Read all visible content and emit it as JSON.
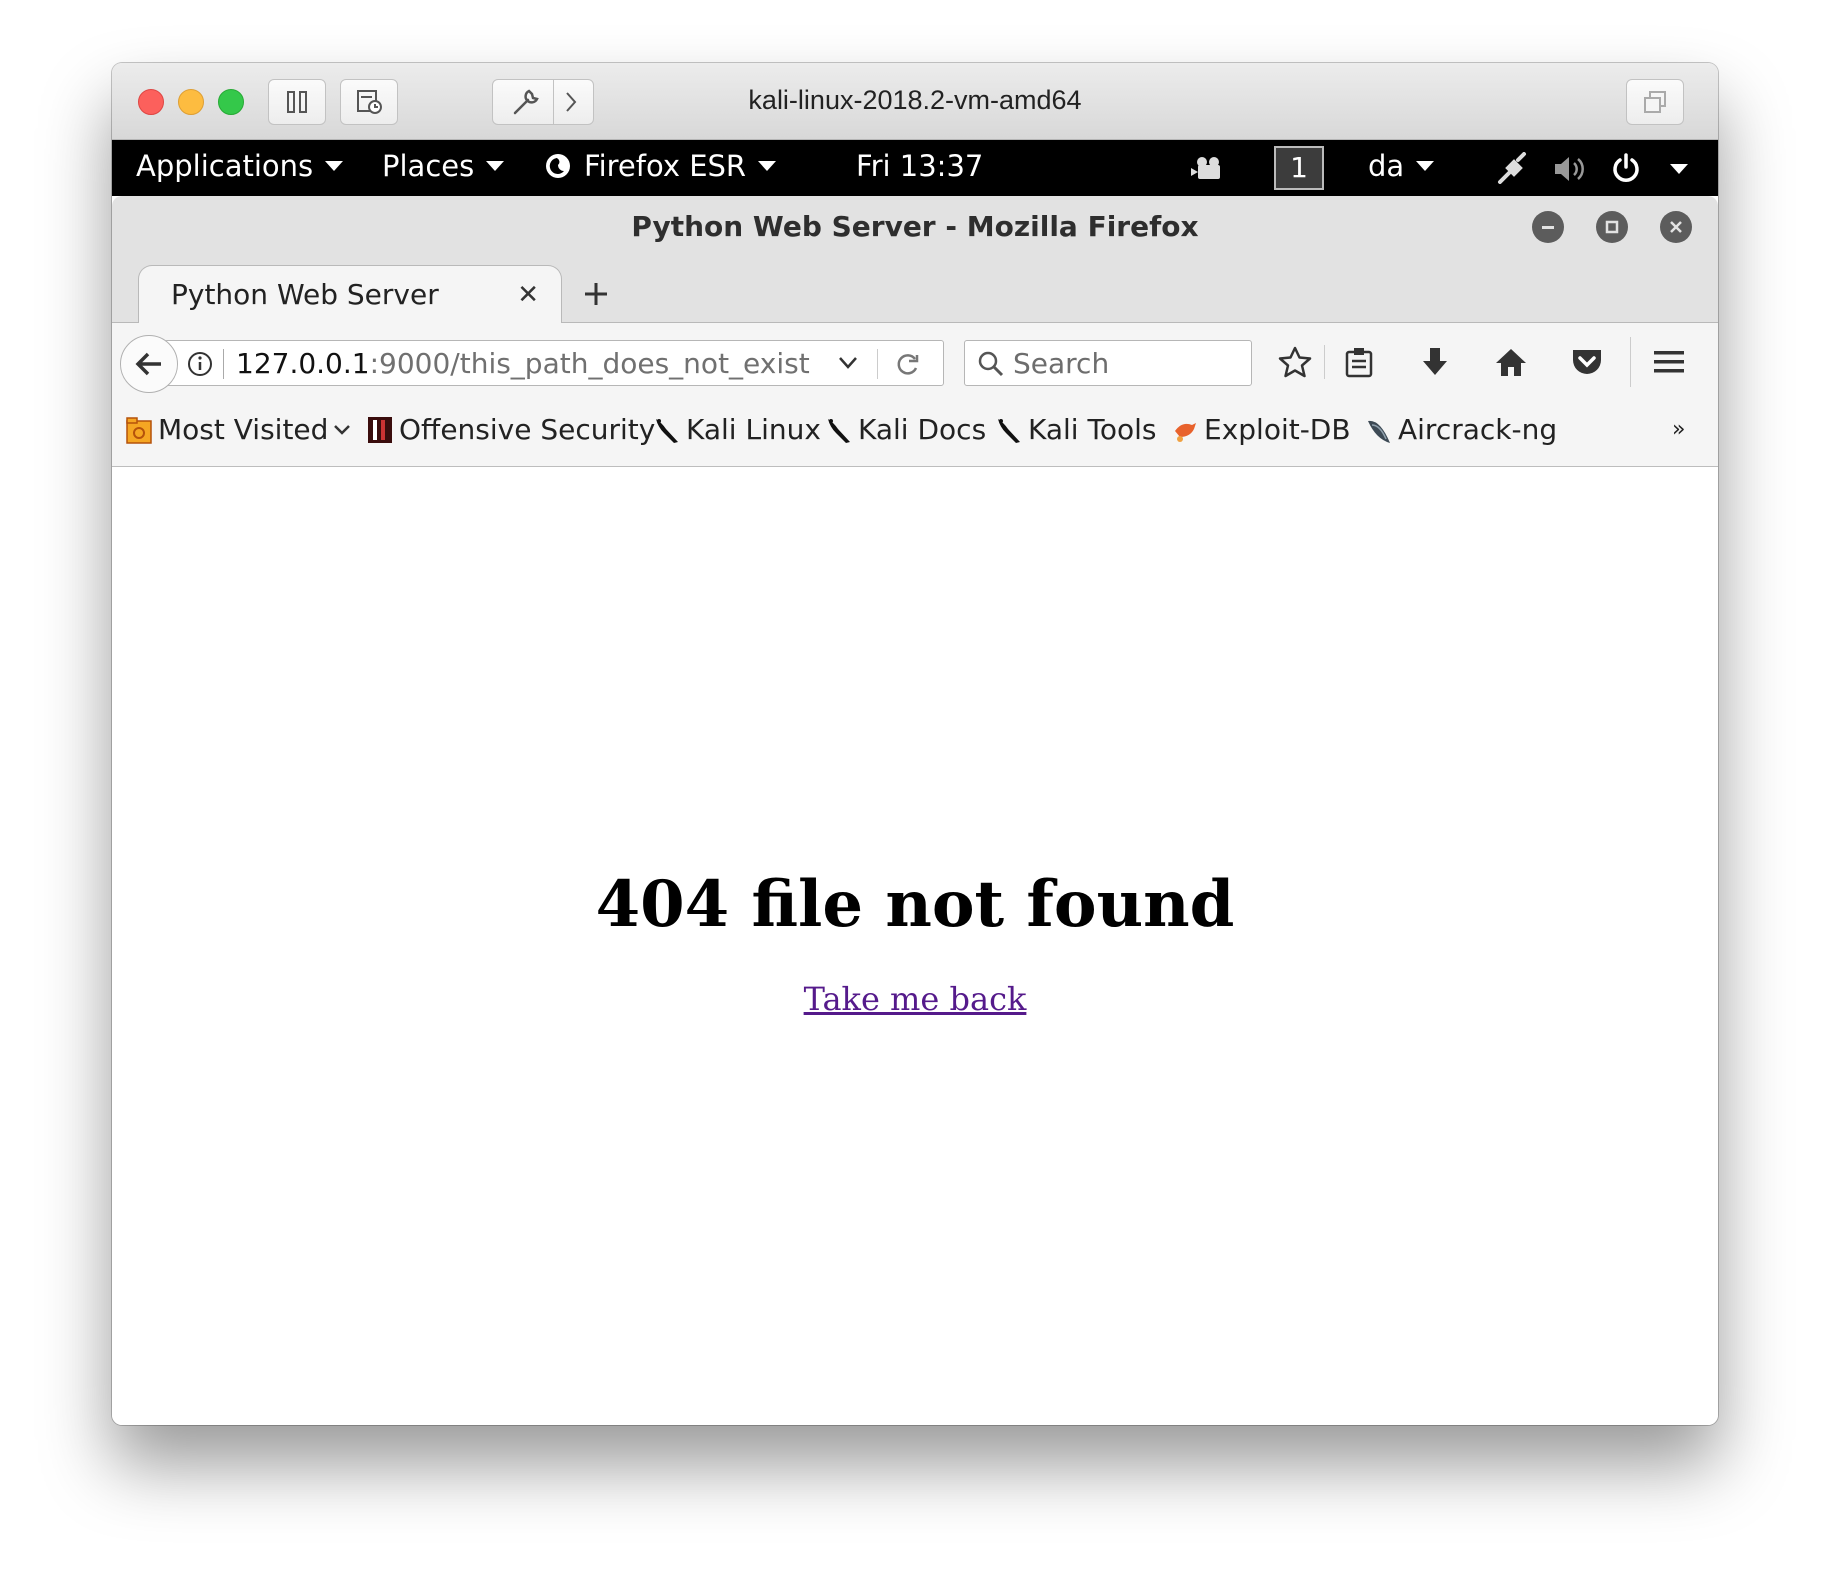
{
  "vm": {
    "title": "kali-linux-2018.2-vm-amd64"
  },
  "panel": {
    "applications": "Applications",
    "places": "Places",
    "app_name": "Firefox ESR",
    "clock": "Fri 13:37",
    "workspace": "1",
    "keyboard": "da"
  },
  "firefox": {
    "window_title": "Python Web Server - Mozilla Firefox",
    "tab_label": "Python Web Server",
    "url_host": "127.0.0.1",
    "url_rest": ":9000/this_path_does_not_exist",
    "search_placeholder": "Search"
  },
  "bookmarks": [
    {
      "label": "Most Visited",
      "icon": "folder-icon"
    },
    {
      "label": "Offensive Security",
      "icon": "offsec-icon"
    },
    {
      "label": "Kali Linux",
      "icon": "kali-dragon-icon"
    },
    {
      "label": "Kali Docs",
      "icon": "kali-dragon-icon"
    },
    {
      "label": "Kali Tools",
      "icon": "kali-dragon-icon"
    },
    {
      "label": "Exploit-DB",
      "icon": "exploit-db-icon"
    },
    {
      "label": "Aircrack-ng",
      "icon": "aircrack-icon"
    }
  ],
  "bookmarks_overflow": "»",
  "page": {
    "heading": "404 file not found",
    "link_text": "Take me back"
  },
  "colors": {
    "link_visited": "#551a8b",
    "panel_bg": "#000000"
  }
}
